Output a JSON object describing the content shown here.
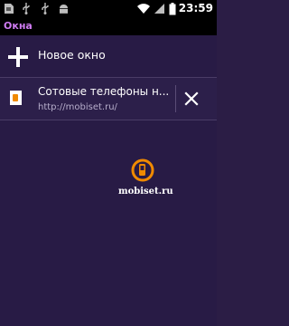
{
  "status_bar": {
    "time": "23:59",
    "icons": [
      "sim-card-icon",
      "usb-icon",
      "usb-icon",
      "android-debug-icon",
      "wifi-icon",
      "signal-icon",
      "battery-icon"
    ]
  },
  "title_bar": {
    "title": "Окна"
  },
  "new_window": {
    "label": "Новое окно",
    "icon": "plus-icon"
  },
  "tabs": [
    {
      "title": "Сотовые телефоны н...",
      "url": "http://mobiset.ru/",
      "icon": "favicon-icon",
      "close_icon": "close-icon"
    }
  ],
  "watermark": {
    "text": "mobiset.ru",
    "icon": "mobiset-logo-icon"
  },
  "colors": {
    "background": "#281b45",
    "title_text": "#d07cf3",
    "status_bar": "#000000",
    "logo_orange": "#f08a00"
  }
}
